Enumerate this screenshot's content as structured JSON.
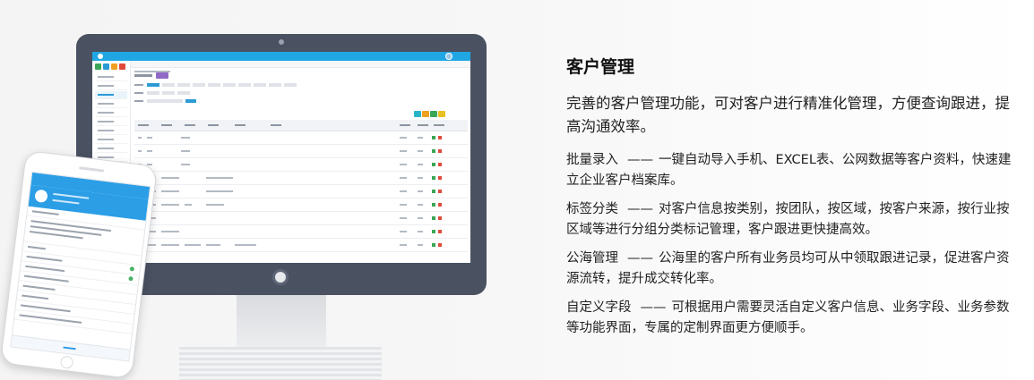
{
  "section": {
    "title": "客户管理",
    "lead": "完善的客户管理功能，可对客户进行精准化管理，方便查询跟进，提高沟通效率。"
  },
  "features": [
    {
      "name": "批量录入",
      "dash": "——",
      "desc": "一键自动导入手机、EXCEL表、公网数据等客户资料，快速建立企业客户档案库。"
    },
    {
      "name": "标签分类",
      "dash": "——",
      "desc": "对客户信息按类别，按团队，按区域，按客户来源，按行业按区域等进行分组分类标记管理，客户跟进更快捷高效。"
    },
    {
      "name": "公海管理",
      "dash": "——",
      "desc": "公海里的客户所有业务员均可从中领取跟进记录，促进客户资源流转，提升成交转化率。"
    },
    {
      "name": "自定义字段",
      "dash": "——",
      "desc": "可根据用户需要灵活自定义客户信息、业务字段、业务参数等功能界面，专属的定制界面更方便顺手。"
    }
  ],
  "colors": {
    "monitor_frame": "#4a5262",
    "app_accent": "#21a6e4",
    "phone_accent": "#2b9ee6",
    "text": "#222222"
  },
  "icons": {
    "monitor": "monitor-icon",
    "phone": "phone-icon",
    "call": "call-icon"
  }
}
